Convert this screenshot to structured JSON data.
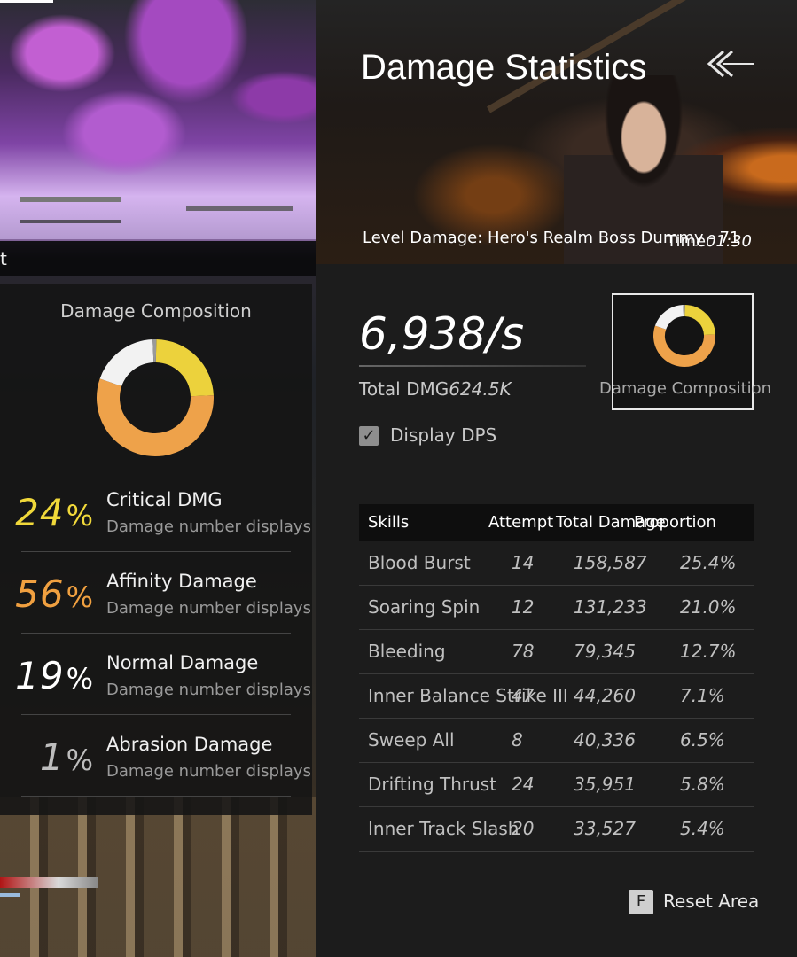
{
  "scene": {
    "location_label": "t"
  },
  "composition_panel": {
    "title": "Damage Composition",
    "items": [
      {
        "percent": "24",
        "sign": "%",
        "label": "Critical DMG",
        "desc": "Damage number displays a",
        "color": "#f0d83a"
      },
      {
        "percent": "56",
        "sign": "%",
        "label": "Affinity Damage",
        "desc": "Damage number displays a",
        "color": "#f0a040"
      },
      {
        "percent": "19",
        "sign": "%",
        "label": "Normal Damage",
        "desc": "Damage number displays a",
        "color": "#ffffff"
      },
      {
        "percent": "1",
        "sign": "%",
        "label": "Abrasion Damage",
        "desc": "Damage number displays a",
        "color": "#bdbdbd"
      }
    ],
    "donut": [
      {
        "name": "Critical DMG",
        "value": 24,
        "color": "#ecd23c"
      },
      {
        "name": "Affinity Damage",
        "value": 56,
        "color": "#eea24a"
      },
      {
        "name": "Normal Damage",
        "value": 19,
        "color": "#f2f2f2"
      },
      {
        "name": "Abrasion Damage",
        "value": 1,
        "color": "#9a9a9a"
      }
    ]
  },
  "header": {
    "title": "Damage Statistics",
    "level": "Level Damage: Hero's Realm Boss Dummy - 71",
    "time_label": "Time",
    "time_value": "01:30",
    "back_icon": "double-chevron-left-icon"
  },
  "stats": {
    "dps": "6,938/s",
    "total_label": "Total DMG",
    "total_value": "624.5K",
    "display_dps_label": "Display DPS",
    "display_dps_checked": true,
    "composition_button_label": "Damage Composition"
  },
  "table": {
    "headers": {
      "skills": "Skills",
      "attempt": "Attempt",
      "total": "Total Damage",
      "proportion": "Proportion"
    },
    "rows": [
      {
        "skill": "Blood Burst",
        "attempt": "14",
        "total": "158,587",
        "proportion": "25.4%"
      },
      {
        "skill": "Soaring Spin",
        "attempt": "12",
        "total": "131,233",
        "proportion": "21.0%"
      },
      {
        "skill": "Bleeding",
        "attempt": "78",
        "total": "79,345",
        "proportion": "12.7%"
      },
      {
        "skill": "Inner Balance Strike III",
        "attempt": "47",
        "total": "44,260",
        "proportion": "7.1%"
      },
      {
        "skill": "Sweep All",
        "attempt": "8",
        "total": "40,336",
        "proportion": "6.5%"
      },
      {
        "skill": "Drifting Thrust",
        "attempt": "24",
        "total": "35,951",
        "proportion": "5.8%"
      },
      {
        "skill": "Inner Track Slash",
        "attempt": "20",
        "total": "33,527",
        "proportion": "5.4%"
      }
    ]
  },
  "footer": {
    "reset_key": "F",
    "reset_label": "Reset Area"
  }
}
